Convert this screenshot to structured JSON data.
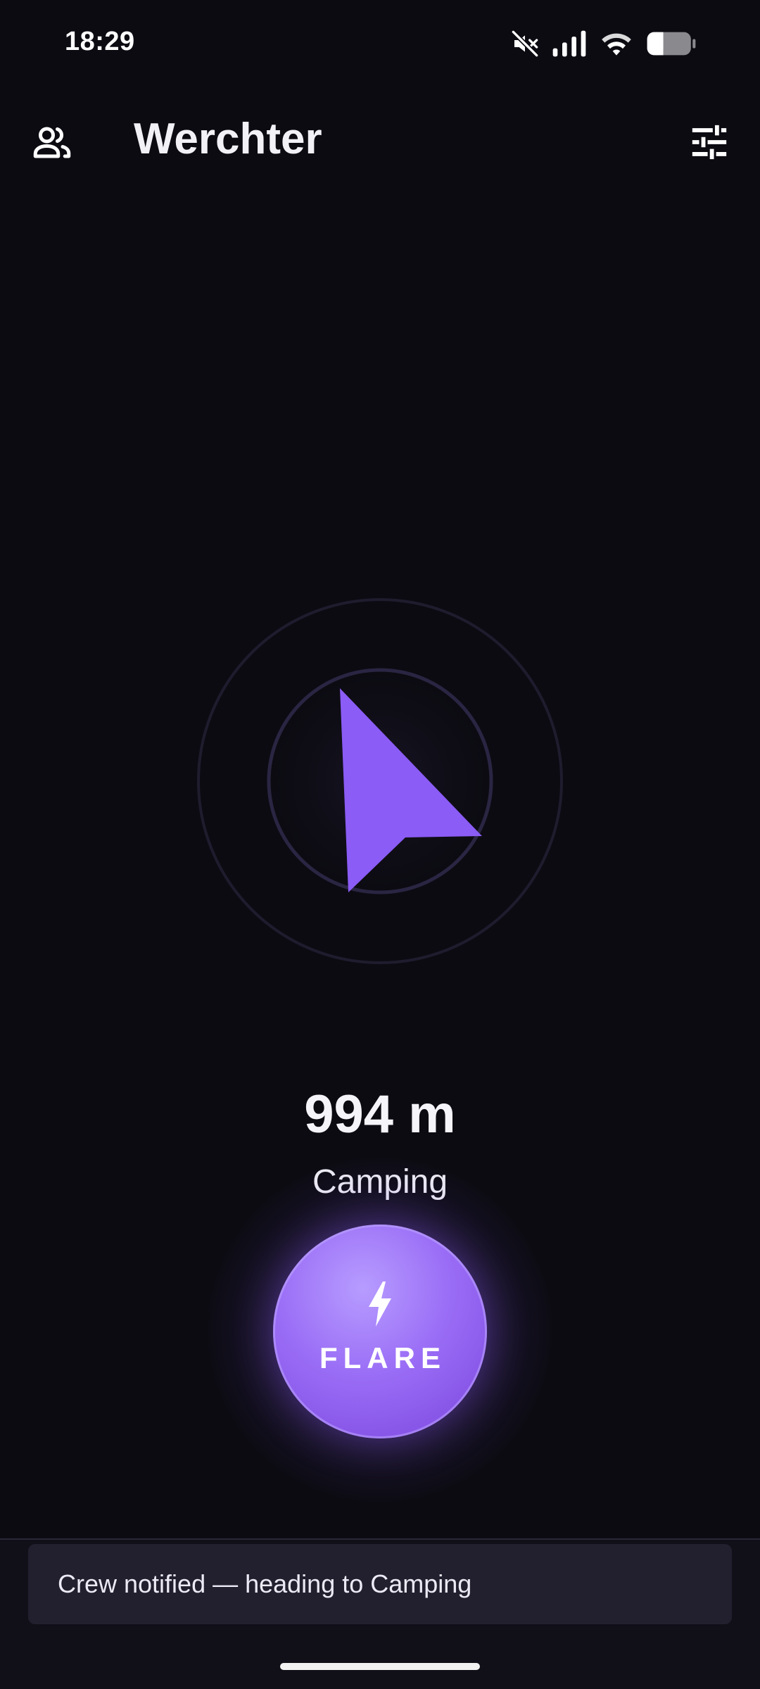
{
  "status_bar": {
    "time": "18:29",
    "icons": [
      "mute-icon",
      "signal-icon",
      "wifi-icon",
      "battery-icon"
    ]
  },
  "app_bar": {
    "title": "Werchter",
    "left_icon": "crew-icon",
    "right_icon": "filters-icon"
  },
  "compass": {
    "accent_color": "#8b5cf6",
    "ring_color": "#25213a",
    "arrow_icon": "navigation-arrow-icon"
  },
  "target": {
    "distance": "994 m",
    "name": "Camping"
  },
  "flare_button": {
    "label": "FLARE",
    "icon": "bolt-icon"
  },
  "snackbar": {
    "message": "Crew notified — heading to Camping"
  }
}
